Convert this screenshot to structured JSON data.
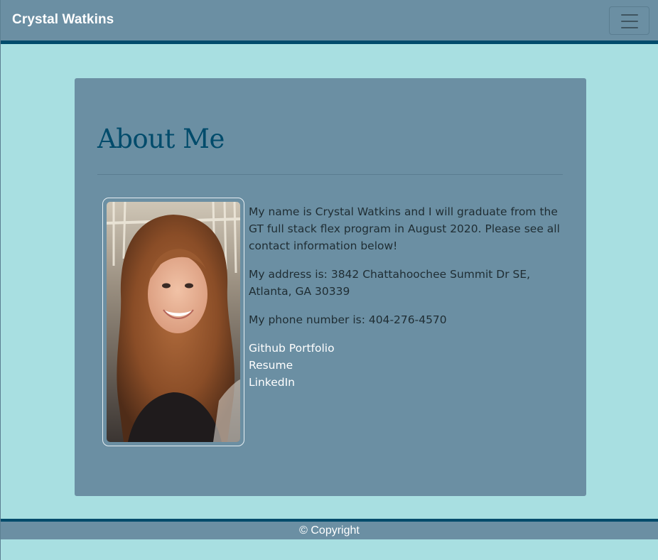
{
  "navbar": {
    "brand": "Crystal Watkins",
    "toggle_icon": "hamburger-menu-icon"
  },
  "about": {
    "heading": "About Me",
    "photo_alt": "Portrait of Crystal Watkins",
    "paragraphs": [
      "My name is Crystal Watkins and I will graduate from the GT full stack flex program in August 2020. Please see all contact information below!",
      "My address is: 3842 Chattahoochee Summit Dr SE, Atlanta, GA 30339",
      "My phone number is: 404-276-4570"
    ],
    "links": [
      "Github Portfolio",
      "Resume",
      "LinkedIn"
    ]
  },
  "footer": {
    "text": "© Copyright"
  },
  "colors": {
    "background": "#a8dfe1",
    "panel": "#6b8fa3",
    "accent": "#004b6b",
    "link": "#ffffff"
  }
}
